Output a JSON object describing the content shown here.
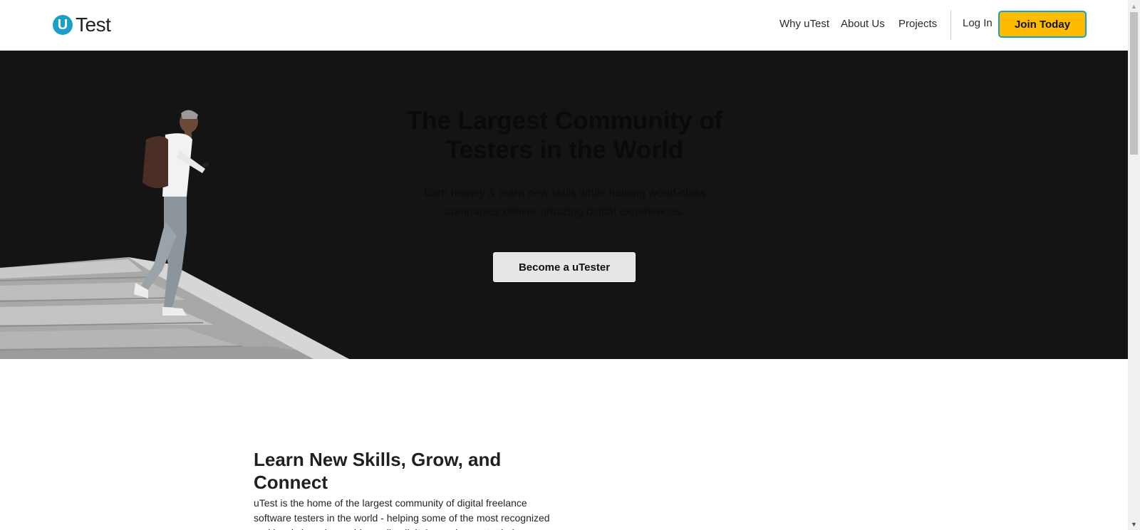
{
  "header": {
    "logo_letter": "U",
    "logo_text": "Test",
    "nav": {
      "why": "Why uTest",
      "about": "About Us",
      "projects": "Projects",
      "login": "Log In",
      "join": "Join Today"
    }
  },
  "hero": {
    "title": "The Largest Community of Testers in the World",
    "subtitle": "Earn money & learn new skills while helping world-class companies deliver amazing digital experiences.",
    "cta": "Become a uTester"
  },
  "section": {
    "heading": "Learn New Skills, Grow, and Connect",
    "body": "uTest is the home of the largest community of digital freelance software testers in the world - helping some of the most recognized and iconic brands provide quality digital experiences to their"
  },
  "colors": {
    "accent_yellow": "#ffbb00",
    "accent_blue": "#1aa0c8",
    "hero_bg": "#141414"
  },
  "icons": {
    "scroll_up": "chevron-up-icon",
    "scroll_down": "chevron-down-icon"
  }
}
